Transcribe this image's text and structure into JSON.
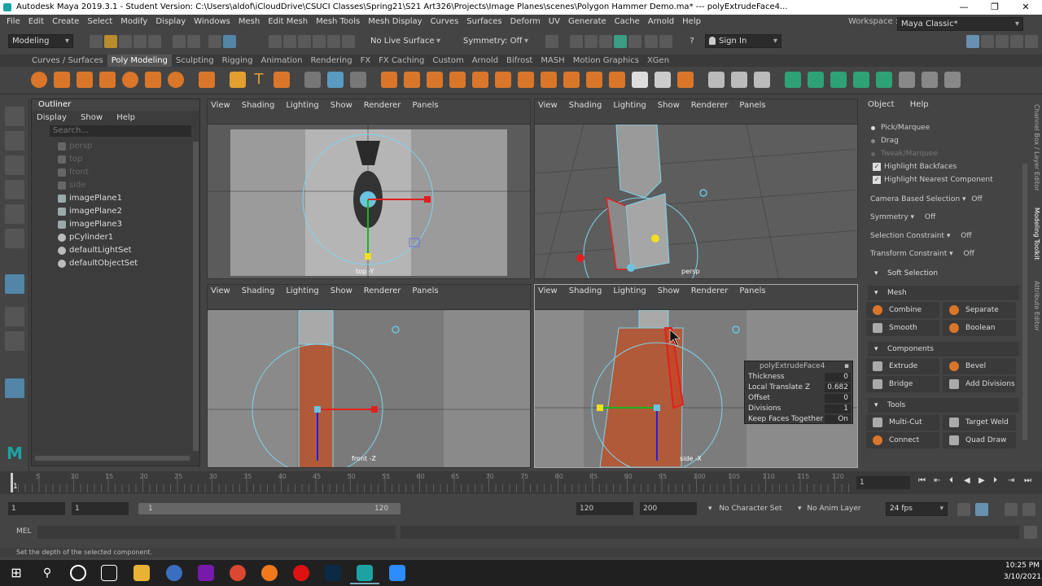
{
  "window": {
    "title": "Autodesk Maya 2019.3.1 - Student Version: C:\\Users\\aldof\\iCloudDrive\\CSUCI Classes\\Spring21\\S21 Art326\\Projects\\Image Planes\\scenes\\Polygon Hammer Demo.ma*   ---   polyExtrudeFace4...",
    "minimize": "—",
    "maximize": "❐",
    "close": "✕"
  },
  "menu": [
    "File",
    "Edit",
    "Create",
    "Select",
    "Modify",
    "Display",
    "Windows",
    "Mesh",
    "Edit Mesh",
    "Mesh Tools",
    "Mesh Display",
    "Curves",
    "Surfaces",
    "Deform",
    "UV",
    "Generate",
    "Cache",
    "Arnold",
    "Help"
  ],
  "workspace": {
    "label": "Workspace :",
    "value": "Maya Classic*"
  },
  "status": {
    "menuset": "Modeling",
    "live_surface": "No Live Surface",
    "symmetry": "Symmetry: Off",
    "sign_in": "Sign In"
  },
  "shelf_tabs": [
    "Curves / Surfaces",
    "Poly Modeling",
    "Sculpting",
    "Rigging",
    "Animation",
    "Rendering",
    "FX",
    "FX Caching",
    "Custom",
    "Arnold",
    "Bifrost",
    "MASH",
    "Motion Graphics",
    "XGen"
  ],
  "shelf_active": "Poly Modeling",
  "outliner": {
    "title": "Outliner",
    "menu": [
      "Display",
      "Show",
      "Help"
    ],
    "search_placeholder": "Search...",
    "items": [
      {
        "label": "persp",
        "dim": true
      },
      {
        "label": "top",
        "dim": true
      },
      {
        "label": "front",
        "dim": true
      },
      {
        "label": "side",
        "dim": true
      },
      {
        "label": "imagePlane1",
        "dim": false
      },
      {
        "label": "imagePlane2",
        "dim": false
      },
      {
        "label": "imagePlane3",
        "dim": false
      },
      {
        "label": "pCylinder1",
        "dim": false
      },
      {
        "label": "defaultLightSet",
        "dim": false
      },
      {
        "label": "defaultObjectSet",
        "dim": false
      }
    ]
  },
  "viewport_menu": [
    "View",
    "Shading",
    "Lighting",
    "Show",
    "Renderer",
    "Panels"
  ],
  "viewports": {
    "top": "top -Y",
    "persp": "persp",
    "front": "front -Z",
    "side": "side -X"
  },
  "extrude_popup": {
    "title": "polyExtrudeFace4",
    "rows": [
      {
        "label": "Thickness",
        "value": "0"
      },
      {
        "label": "Local Translate Z",
        "value": "0.682"
      },
      {
        "label": "Offset",
        "value": "0"
      },
      {
        "label": "Divisions",
        "value": "1"
      },
      {
        "label": "Keep Faces Together",
        "value": "On"
      }
    ]
  },
  "modeling_toolkit": {
    "tabs": [
      "Object",
      "Help"
    ],
    "pick_marquee": "Pick/Marquee",
    "drag": "Drag",
    "tweak_marquee": "Tweak/Marquee",
    "highlight_backfaces": "Highlight Backfaces",
    "highlight_nearest": "Highlight Nearest Component",
    "camera_based": {
      "label": "Camera Based Selection",
      "value": "Off"
    },
    "symmetry": {
      "label": "Symmetry",
      "value": "Off"
    },
    "selection_constraint": {
      "label": "Selection Constraint",
      "value": "Off"
    },
    "transform_constraint": {
      "label": "Transform Constraint",
      "value": "Off"
    },
    "soft_selection": "Soft Selection",
    "mesh": "Mesh",
    "combine": "Combine",
    "separate": "Separate",
    "smooth": "Smooth",
    "boolean": "Boolean",
    "components": "Components",
    "extrude": "Extrude",
    "bevel": "Bevel",
    "bridge": "Bridge",
    "add_divisions": "Add Divisions",
    "tools": "Tools",
    "multi_cut": "Multi-Cut",
    "target_weld": "Target Weld",
    "connect": "Connect",
    "quad_draw": "Quad Draw"
  },
  "side_tabs": [
    "Channel Box / Layer Editor",
    "Modeling Toolkit",
    "Attribute Editor"
  ],
  "timeline": {
    "ticks": [
      "5",
      "10",
      "15",
      "20",
      "25",
      "30",
      "35",
      "40",
      "45",
      "50",
      "55",
      "60",
      "65",
      "70",
      "75",
      "80",
      "85",
      "90",
      "95",
      "100",
      "105",
      "110",
      "115",
      "120"
    ],
    "start_marker": "1",
    "current_frame": "1"
  },
  "range": {
    "start": "1",
    "start2": "1",
    "slider_start": "1",
    "slider_end": "120",
    "end": "120",
    "end2": "200",
    "character_set": "No Character Set",
    "anim_layer": "No Anim Layer",
    "fps": "24 fps"
  },
  "cmd": {
    "label": "MEL"
  },
  "help_line": "Set the depth of the selected component.",
  "taskbar": {
    "time": "10:25 PM",
    "date": "3/10/2021"
  }
}
